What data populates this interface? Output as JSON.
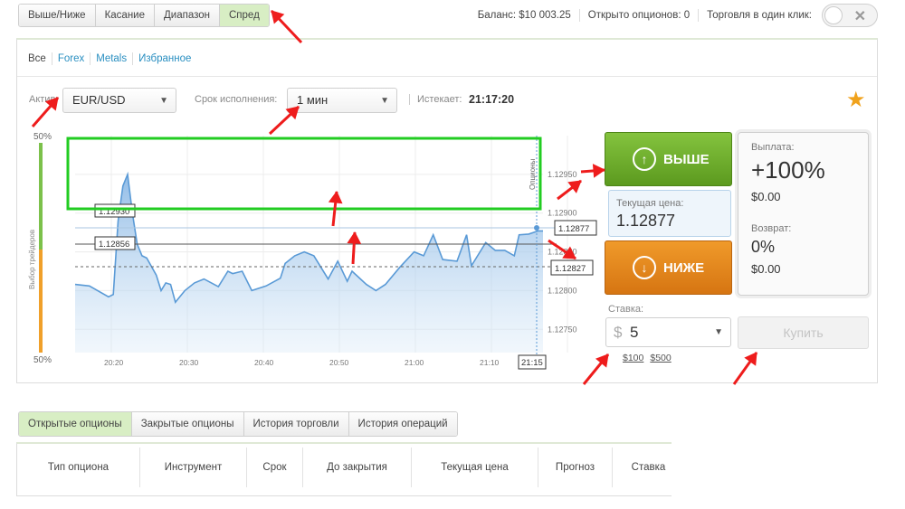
{
  "type_tabs": [
    "Выше/Ниже",
    "Касание",
    "Диапазон",
    "Спред"
  ],
  "stats": {
    "balance": "Баланс: $10 003.25",
    "open_options": "Открыто опционов: 0",
    "one_click": "Торговля в один клик:"
  },
  "asset_tabs": [
    "Все",
    "Forex",
    "Metals",
    "Избранное"
  ],
  "asset": {
    "label": "Актив:",
    "value": "EUR/USD"
  },
  "expiry": {
    "label": "Срок исполнения:",
    "value": "1 мин"
  },
  "expires": {
    "label": "Истекает:",
    "value": "21:17:20"
  },
  "trade": {
    "up_label": "ВЫШЕ",
    "down_label": "НИЖЕ",
    "current_label": "Текущая цена:",
    "current_value": "1.12877",
    "payout_label": "Выплата:",
    "payout_value": "+100%",
    "payout_amount": "$0.00",
    "return_label": "Возврат:",
    "return_value": "0%",
    "return_amount": "$0.00",
    "stake_label": "Ставка:",
    "stake_currency": "$",
    "stake_value": "5",
    "quick_100": "$100",
    "quick_500": "$500",
    "buy_label": "Купить"
  },
  "chart_labels": {
    "sentiment_top": "50%",
    "sentiment_bottom": "50%",
    "sentiment_title": "Выбор трейдеров",
    "expiry_tag": "Опционы",
    "time_tag": "21:15",
    "label_entry": "1.12856",
    "label_top": "1.12930",
    "label_current": "1.12877",
    "label_dashed": "1.12827"
  },
  "chart_data": {
    "type": "area",
    "x_ticks": [
      "20:20",
      "20:30",
      "20:40",
      "20:50",
      "21:00",
      "21:10"
    ],
    "y_ticks": [
      "1.12950",
      "1.12900",
      "1.12850",
      "1.12800",
      "1.12750"
    ],
    "ylim": [
      1.1272,
      1.13
    ],
    "series": [
      {
        "x": [
          0,
          3,
          7,
          8,
          9,
          10,
          11,
          12,
          13,
          14,
          15,
          17,
          18,
          19,
          20,
          21,
          23,
          25,
          27,
          30,
          32,
          33,
          35,
          37,
          40,
          43,
          44,
          46,
          48,
          50,
          53,
          55,
          57,
          58,
          61,
          63,
          65,
          68,
          71,
          73,
          75,
          77,
          80,
          82,
          83,
          86,
          88,
          90,
          92,
          93,
          95,
          97,
          98
        ],
        "values": [
          1.12808,
          1.12806,
          1.12792,
          1.12795,
          1.1289,
          1.12935,
          1.1295,
          1.129,
          1.1286,
          1.12845,
          1.12842,
          1.1282,
          1.128,
          1.1281,
          1.12808,
          1.12785,
          1.128,
          1.1281,
          1.12815,
          1.12805,
          1.12825,
          1.12822,
          1.12825,
          1.128,
          1.12806,
          1.12816,
          1.12835,
          1.12845,
          1.1285,
          1.12845,
          1.12815,
          1.12838,
          1.12812,
          1.12825,
          1.12808,
          1.128,
          1.12808,
          1.1283,
          1.1285,
          1.12845,
          1.12872,
          1.1284,
          1.12838,
          1.12872,
          1.12832,
          1.12862,
          1.12852,
          1.12852,
          1.12845,
          1.12872,
          1.12873,
          1.12877,
          1.12877
        ]
      }
    ]
  }
}
